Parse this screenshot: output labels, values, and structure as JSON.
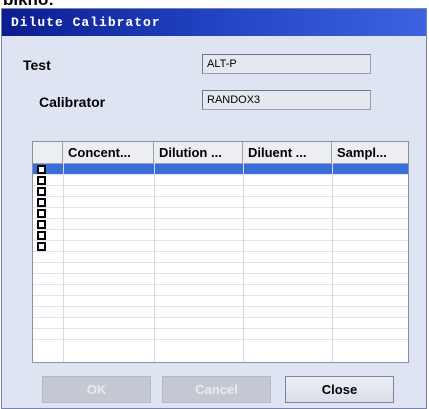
{
  "partial_top_text": "bikho:",
  "window": {
    "title": "Dilute Calibrator"
  },
  "form": {
    "test_label": "Test",
    "test_value": "ALT-P",
    "calibrator_label": "Calibrator",
    "calibrator_value": "RANDOX3"
  },
  "grid": {
    "columns": [
      "",
      "Concent...",
      "Dilution ...",
      "Diluent ...",
      "Sampl..."
    ],
    "row_count": 16,
    "checkbox_rows": 8,
    "selected_row": 1
  },
  "buttons": {
    "ok": "OK",
    "cancel": "Cancel",
    "close": "Close"
  },
  "colors": {
    "title_bar": "#0b1d8f",
    "selected_row": "#3a6fd8",
    "window_bg": "#dfe4f3"
  }
}
